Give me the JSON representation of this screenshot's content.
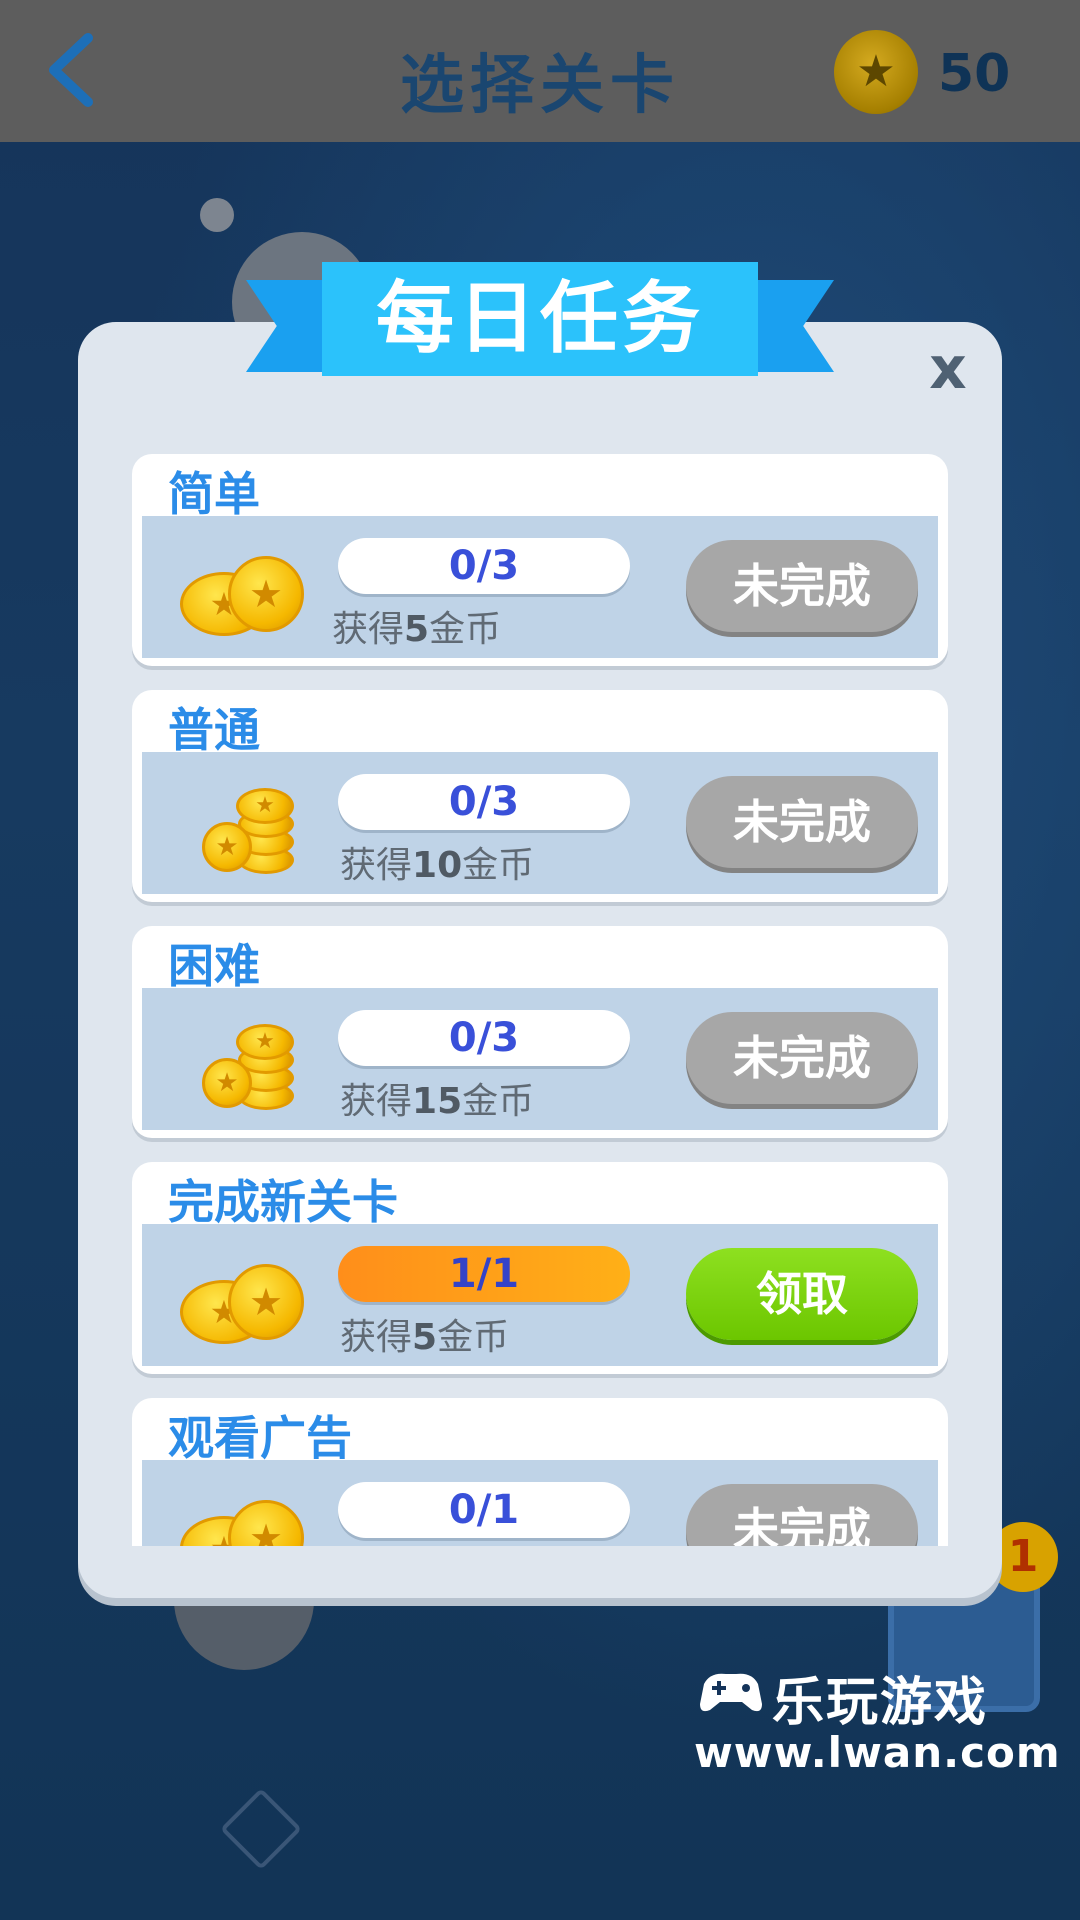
{
  "header": {
    "title": "选择关卡",
    "coins": "50"
  },
  "dialog": {
    "title": "每日任务",
    "close_label": "x",
    "tasks": [
      {
        "name": "简单",
        "progress": "0/3",
        "reward_prefix": "获得",
        "reward_amount": "5",
        "reward_suffix": "金币",
        "status": "未完成"
      },
      {
        "name": "普通",
        "progress": "0/3",
        "reward_prefix": "获得",
        "reward_amount": "10",
        "reward_suffix": "金币",
        "status": "未完成"
      },
      {
        "name": "困难",
        "progress": "0/3",
        "reward_prefix": "获得",
        "reward_amount": "15",
        "reward_suffix": "金币",
        "status": "未完成"
      },
      {
        "name": "完成新关卡",
        "progress": "1/1",
        "reward_prefix": "获得",
        "reward_amount": "5",
        "reward_suffix": "金币",
        "status": "领取"
      },
      {
        "name": "观看广告",
        "progress": "0/1",
        "status": "未完成"
      }
    ]
  },
  "background": {
    "badge_count": "1"
  },
  "watermark": {
    "brand": "乐玩游戏",
    "url": "www.lwan.com"
  },
  "colors": {
    "ribbon": "#2bc2fb",
    "title_blue": "#2b8ce8",
    "progress_text": "#3950d9",
    "claim_green": "#7ad50c",
    "disabled_gray": "#a7a7a7"
  }
}
